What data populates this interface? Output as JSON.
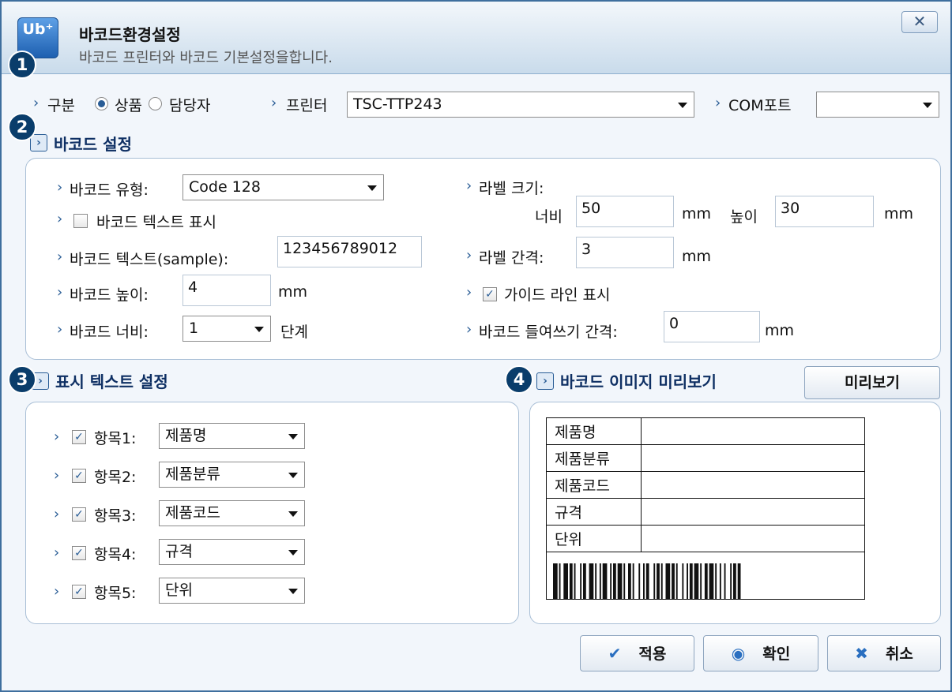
{
  "window": {
    "title": "바코드환경설정",
    "subtitle": "바코드 프린터와 바코드 기본설정을합니다.",
    "logo_text": "Ub⁺",
    "close_icon": "close-icon"
  },
  "badges": [
    "1",
    "2",
    "3",
    "4"
  ],
  "top": {
    "category_label": "구분",
    "radio_product": "상품",
    "radio_manager": "담당자",
    "selected": "상품",
    "printer_label": "프린터",
    "printer_value": "TSC-TTP243",
    "com_label": "COM포트",
    "com_value": ""
  },
  "barcode_settings": {
    "heading": "바코드 설정",
    "type_label": "바코드 유형:",
    "type_value": "Code 128",
    "show_text_label": "바코드 텍스트 표시",
    "show_text_checked": false,
    "text_label": "바코드 텍스트(sample):",
    "text_value": "123456789012",
    "height_label": "바코드 높이:",
    "height_value": "4",
    "height_unit": "mm",
    "width_label": "바코드 너비:",
    "width_value": "1",
    "width_unit": "단계",
    "label_size_label": "라벨 크기:",
    "label_width_label": "너비",
    "label_width_value": "50",
    "label_width_unit": "mm",
    "label_height_label": "높이",
    "label_height_value": "30",
    "label_height_unit": "mm",
    "gap_label": "라벨 간격:",
    "gap_value": "3",
    "gap_unit": "mm",
    "guide_label": "가이드 라인 표시",
    "guide_checked": true,
    "indent_label": "바코드 들여쓰기 간격:",
    "indent_value": "0",
    "indent_unit": "mm"
  },
  "text_settings": {
    "heading": "표시 텍스트 설정",
    "items": [
      {
        "label": "항목1:",
        "value": "제품명",
        "checked": true
      },
      {
        "label": "항목2:",
        "value": "제품분류",
        "checked": true
      },
      {
        "label": "항목3:",
        "value": "제품코드",
        "checked": true
      },
      {
        "label": "항목4:",
        "value": "규격",
        "checked": true
      },
      {
        "label": "항목5:",
        "value": "단위",
        "checked": true
      }
    ]
  },
  "preview": {
    "heading": "바코드 이미지 미리보기",
    "button": "미리보기",
    "rows": [
      "제품명",
      "제품분류",
      "제품코드",
      "규격",
      "단위"
    ]
  },
  "footer": {
    "apply": "적용",
    "apply_icon": "check-icon",
    "ok": "확인",
    "ok_icon": "dot-icon",
    "cancel": "취소",
    "cancel_icon": "x-icon"
  },
  "colors": {
    "accent": "#0a3d6b",
    "heading": "#0e2f63",
    "border": "#3f6f9e"
  }
}
